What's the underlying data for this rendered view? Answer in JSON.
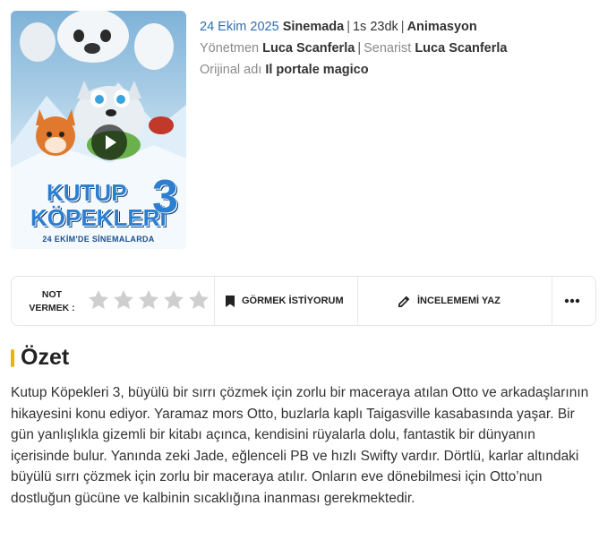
{
  "poster": {
    "title_line1": "KUTUP",
    "title_line2": "KÖPEKLERİ",
    "title_number": "3",
    "tagline": "24 EKİM'DE SİNEMALARDA",
    "play_icon": "play-icon"
  },
  "meta": {
    "release_date": "24 Ekim 2025",
    "release_status": "Sinemada",
    "duration": "1s 23dk",
    "genre": "Animasyon",
    "director_label": "Yönetmen",
    "director": "Luca Scanferla",
    "writer_label": "Senarist",
    "writer": "Luca Scanferla",
    "original_title_label": "Orijinal adı",
    "original_title": "Il portale magico",
    "separator": "|"
  },
  "actions": {
    "rate_label_line1": "NOT",
    "rate_label_line2": "VERMEK :",
    "star_count": 5,
    "watchlist_label": "GÖRMEK İSTİYORUM",
    "review_label": "İNCELEMEMİ YAZ",
    "more_icon": "more-dots-icon"
  },
  "summary": {
    "heading": "Özet",
    "text": "Kutup Köpekleri 3, büyülü bir sırrı çözmek için zorlu bir maceraya atılan Otto ve arkadaşlarının hikayesini konu ediyor. Yaramaz mors Otto, buzlarla kaplı Taigasville kasabasında yaşar. Bir gün yanlışlıkla gizemli bir kitabı açınca, kendisini rüyalarla dolu, fantastik bir dünyanın içerisinde bulur. Yanında zeki Jade, eğlenceli PB ve hızlı Swifty vardır. Dörtlü, karlar altındaki büyülü sırrı çözmek için zorlu bir maceraya atılır. Onların eve dönebilmesi için Otto’nun dostluğun gücüne ve kalbinin sıcaklığına inanması gerekmektedir."
  },
  "colors": {
    "date_blue": "#2f6fb0",
    "accent_yellow": "#f2b100",
    "star_gray": "#cfcfcf"
  }
}
